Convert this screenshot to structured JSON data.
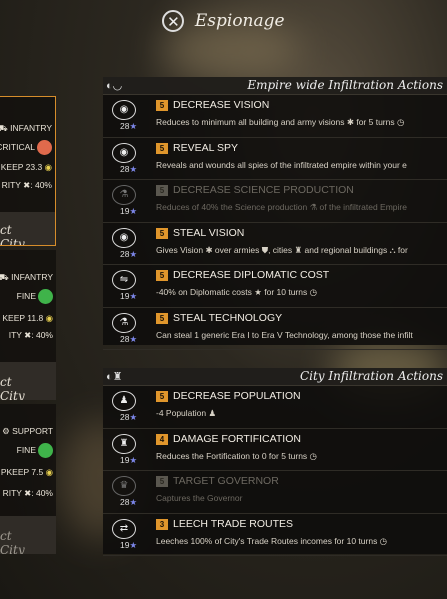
{
  "title": "Espionage",
  "left_cards": [
    {
      "unit_label": "INFANTRY",
      "status": "CRITICAL",
      "upkeep": "KEEP 23.3",
      "prob": "RITY ✖: 40%",
      "city": "ct City",
      "status_color": "#e06a4c"
    },
    {
      "unit_label": "INFANTRY",
      "status": "FINE",
      "upkeep": "KEEP 11.8",
      "prob": "ITY ✖: 40%",
      "city": "ct City",
      "status_color": "#3fb34a"
    },
    {
      "unit_label": "SUPPORT",
      "status": "FINE",
      "upkeep": "PKEEP 7.5",
      "prob": "RITY ✖: 40%",
      "city": "ct City",
      "status_color": "#3fb34a"
    }
  ],
  "empire_panel": {
    "header": "Empire wide Infiltration Actions",
    "actions": [
      {
        "level": "5",
        "name": "DECREASE VISION",
        "desc": "Reduces to minimum all building and army visions ✱ for 5 turns ◷",
        "cost": "28",
        "icon": "eye-icon",
        "enabled": true
      },
      {
        "level": "5",
        "name": "REVEAL SPY",
        "desc": "Reveals and wounds all spies of the infiltrated empire within your e",
        "cost": "28",
        "icon": "eye-icon",
        "enabled": true
      },
      {
        "level": "5",
        "name": "DECREASE SCIENCE PRODUCTION",
        "desc": "Reduces of 40% the Science production ⚗ of the infiltrated Empire",
        "cost": "19",
        "icon": "science-icon",
        "enabled": false
      },
      {
        "level": "5",
        "name": "STEAL VISION",
        "desc": "Gives Vision ✱ over armies ⛊, cities ♜ and regional buildings ⛬ for",
        "cost": "28",
        "icon": "eye-icon",
        "enabled": true
      },
      {
        "level": "5",
        "name": "DECREASE DIPLOMATIC COST",
        "desc": "-40% on Diplomatic costs ★ for 10 turns ◷",
        "cost": "19",
        "icon": "handshake-icon",
        "enabled": true
      },
      {
        "level": "5",
        "name": "STEAL TECHNOLOGY",
        "desc": "Can steal 1 generic Era I to Era V Technology, among those the infilt",
        "cost": "28",
        "icon": "science-icon",
        "enabled": true
      }
    ]
  },
  "city_panel": {
    "header": "City Infiltration Actions",
    "actions": [
      {
        "level": "5",
        "name": "DECREASE POPULATION",
        "desc": "-4 Population ♟",
        "cost": "28",
        "icon": "population-icon",
        "enabled": true
      },
      {
        "level": "4",
        "name": "DAMAGE FORTIFICATION",
        "desc": "Reduces the Fortification to 0 for 5 turns ◷",
        "cost": "19",
        "icon": "fortification-icon",
        "enabled": true
      },
      {
        "level": "5",
        "name": "TARGET GOVERNOR",
        "desc": "Captures the Governor",
        "cost": "28",
        "icon": "crown-icon",
        "enabled": false
      },
      {
        "level": "3",
        "name": "LEECH TRADE ROUTES",
        "desc": "Leeches 100% of City's Trade Routes incomes for 10 turns ◷",
        "cost": "19",
        "icon": "trade-icon",
        "enabled": true
      }
    ]
  }
}
